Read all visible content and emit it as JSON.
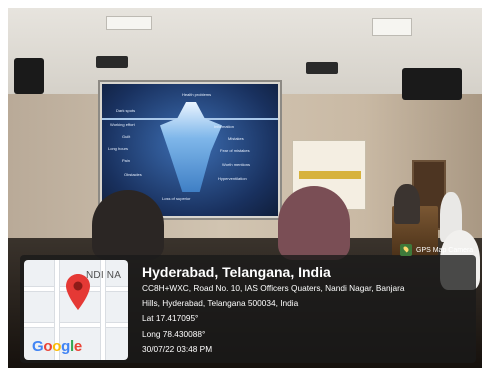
{
  "location": {
    "city": "Hyderabad, Telangana, India",
    "address_line_1": "CC8H+WXC, Road No. 10, IAS Officers Quaters, Nandi Nagar, Banjara",
    "address_line_2": "Hills, Hyderabad, Telangana 500034, India",
    "latitude": "Lat 17.417095°",
    "longitude": "Long 78.430088°",
    "datetime": "30/07/22 03:48 PM"
  },
  "map": {
    "place_label": "NDI NA",
    "provider_logo": [
      {
        "char": "G",
        "color": "#4285F4"
      },
      {
        "char": "o",
        "color": "#EA4335"
      },
      {
        "char": "o",
        "color": "#FBBC05"
      },
      {
        "char": "g",
        "color": "#4285F4"
      },
      {
        "char": "l",
        "color": "#34A853"
      },
      {
        "char": "e",
        "color": "#EA4335"
      }
    ],
    "pin_icon": "map-pin-icon",
    "pin_color": "#E53935"
  },
  "app_badge": {
    "label": "GPS Map Camera",
    "icon": "gps-map-camera-icon"
  },
  "slide": {
    "words": [
      "Dark spots",
      "Working effort",
      "Guilt",
      "Long hours",
      "Pain",
      "Obstacles",
      "Information",
      "Mistakes",
      "Fear of mistakes",
      "Worth mentions",
      "Hyperventilation",
      "Loss of superior",
      "Health problems"
    ]
  }
}
